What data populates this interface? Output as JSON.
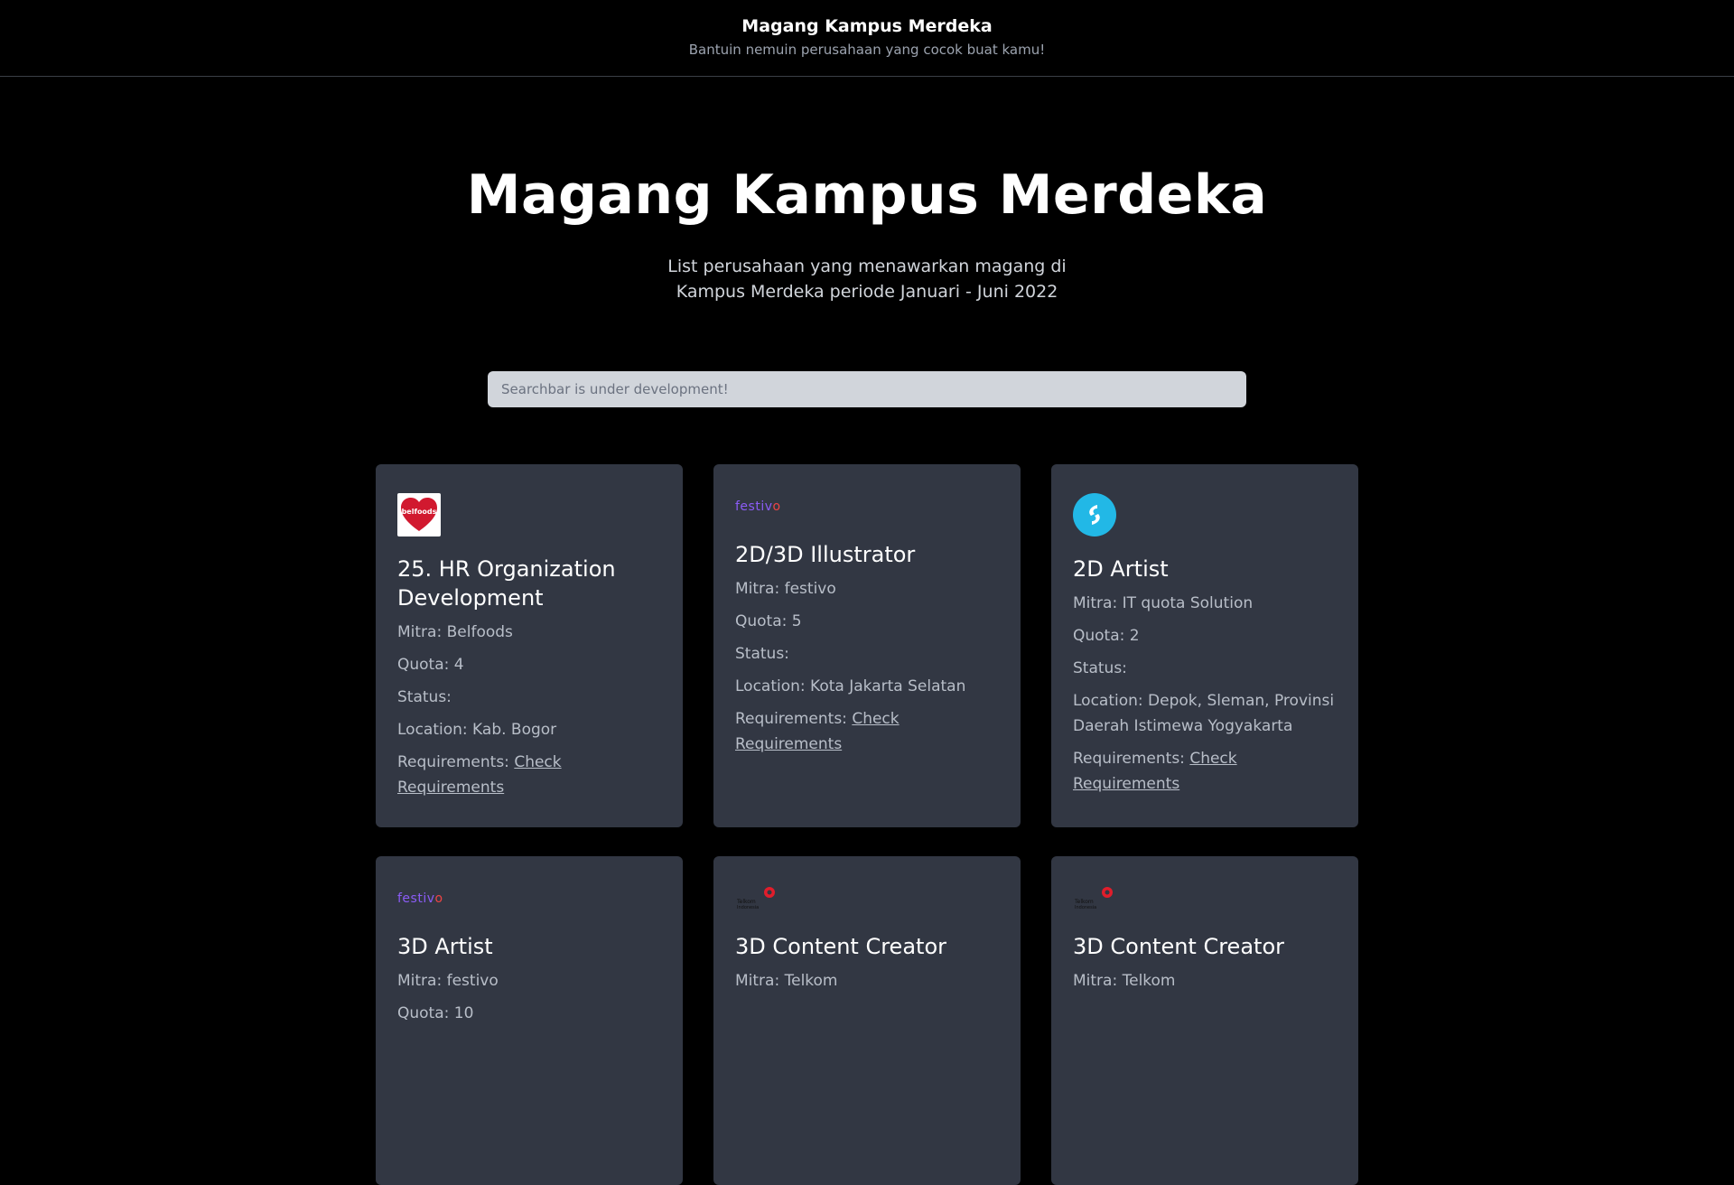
{
  "header": {
    "brand": "Magang Kampus Merdeka",
    "tagline": "Bantuin nemuin perusahaan yang cocok buat kamu!"
  },
  "hero": {
    "title": "Magang Kampus Merdeka",
    "subtitle": "List perusahaan yang menawarkan magang di Kampus Merdeka periode Januari - Juni 2022"
  },
  "search": {
    "placeholder": "Searchbar is under development!"
  },
  "labels": {
    "mitra": "Mitra:",
    "quota": "Quota:",
    "status": "Status:",
    "location": "Location:",
    "requirements": "Requirements:",
    "link": "Check Requirements"
  },
  "cards": [
    {
      "logo": "belfoods-logo",
      "logo_text": "belfoods",
      "title": "25. HR Organization Development",
      "mitra": "Belfoods",
      "quota": "4",
      "status": "",
      "location": "Kab. Bogor"
    },
    {
      "logo": "festivo-logo",
      "logo_text": "festivo",
      "title": "2D/3D Illustrator",
      "mitra": "festivo",
      "quota": "5",
      "status": "",
      "location": "Kota Jakarta Selatan"
    },
    {
      "logo": "it-quota-logo",
      "title": "2D Artist",
      "mitra": "IT quota Solution",
      "quota": "2",
      "status": "",
      "location": "Depok, Sleman, Provinsi Daerah Istimewa Yogyakarta"
    },
    {
      "logo": "festivo-logo",
      "logo_text": "festivo",
      "title": "3D Artist",
      "mitra": "festivo",
      "quota": "10",
      "status": "",
      "location": ""
    },
    {
      "logo": "telkom-logo",
      "logo_text": "Telkom Indonesia",
      "title": "3D Content Creator",
      "mitra": "Telkom",
      "quota": "",
      "status": "",
      "location": ""
    },
    {
      "logo": "telkom-logo",
      "logo_text": "Telkom Indonesia",
      "title": "3D Content Creator",
      "mitra": "Telkom",
      "quota": "",
      "status": "",
      "location": ""
    }
  ],
  "colors": {
    "background": "#000000",
    "card": "#323743",
    "search_bg": "#d1d5db",
    "festivo_purple": "#8b5cf6",
    "telkom_red": "#e11d2b",
    "belfoods_red": "#d1192f",
    "itquota_blue": "#22b8e6"
  }
}
